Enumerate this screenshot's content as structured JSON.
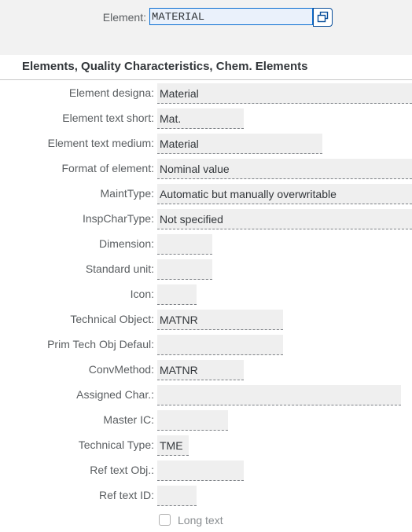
{
  "header": {
    "element_label": "Element:",
    "element_value": "MATERIAL"
  },
  "section": {
    "title": "Elements, Quality Characteristics, Chem. Elements"
  },
  "fields": [
    {
      "label": "Element designa:",
      "value": "Material"
    },
    {
      "label": "Element text short:",
      "value": "Mat."
    },
    {
      "label": "Element text medium:",
      "value": "Material"
    },
    {
      "label": "Format of element:",
      "value": "Nominal value"
    },
    {
      "label": "MaintType:",
      "value": "Automatic but manually overwritable"
    },
    {
      "label": "InspCharType:",
      "value": "Not specified"
    },
    {
      "label": "Dimension:",
      "value": ""
    },
    {
      "label": "Standard unit:",
      "value": ""
    },
    {
      "label": "Icon:",
      "value": ""
    },
    {
      "label": "Technical Object:",
      "value": "MATNR"
    },
    {
      "label": "Prim Tech Obj Defaul:",
      "value": ""
    },
    {
      "label": "ConvMethod:",
      "value": "MATNR"
    },
    {
      "label": "Assigned Char.:",
      "value": ""
    },
    {
      "label": "Master IC:",
      "value": ""
    },
    {
      "label": "Technical Type:",
      "value": "TME"
    },
    {
      "label": "Ref text Obj.:",
      "value": ""
    },
    {
      "label": "Ref text ID:",
      "value": ""
    }
  ],
  "long_text": {
    "label": "Long text",
    "checked": false
  }
}
